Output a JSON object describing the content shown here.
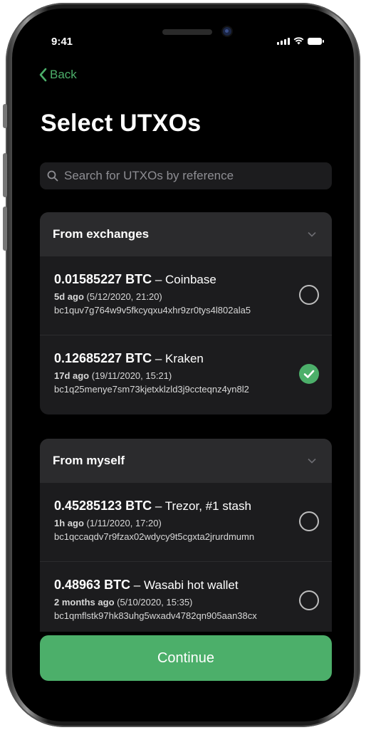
{
  "status_bar": {
    "time": "9:41"
  },
  "nav": {
    "back_label": "Back"
  },
  "page": {
    "title": "Select UTXOs"
  },
  "search": {
    "placeholder": "Search for UTXOs by reference",
    "value": ""
  },
  "groups": [
    {
      "title": "From exchanges",
      "items": [
        {
          "amount": "0.01585227 BTC",
          "source": " – Coinbase",
          "age": "5d ago",
          "datetime": " (5/12/2020, 21:20)",
          "address": "bc1quv7g764w9v5fkcyqxu4xhr9zr0tys4l802ala5",
          "selected": false
        },
        {
          "amount": "0.12685227 BTC",
          "source": " – Kraken",
          "age": "17d ago",
          "datetime": " (19/11/2020, 15:21)",
          "address": "bc1q25menye7sm73kjetxklzld3j9ccteqnz4yn8l2",
          "selected": true
        }
      ]
    },
    {
      "title": "From myself",
      "items": [
        {
          "amount": "0.45285123 BTC",
          "source": " – Trezor, #1 stash",
          "age": "1h ago",
          "datetime": " (1/11/2020, 17:20)",
          "address": "bc1qccaqdv7r9fzax02wdycy9t5cgxta2jrurdmumn",
          "selected": false
        },
        {
          "amount": "0.48963 BTC",
          "source": " – Wasabi hot wallet",
          "age": "2 months ago",
          "datetime": " (5/10/2020, 15:35)",
          "address": "bc1qmflstk97hk83uhg5wxadv4782qn905aan38cx",
          "selected": false
        }
      ]
    }
  ],
  "actions": {
    "continue_label": "Continue"
  },
  "colors": {
    "accent": "#4caf6a",
    "background": "#000000",
    "card": "#1c1c1e",
    "card_header": "#2b2b2d"
  }
}
